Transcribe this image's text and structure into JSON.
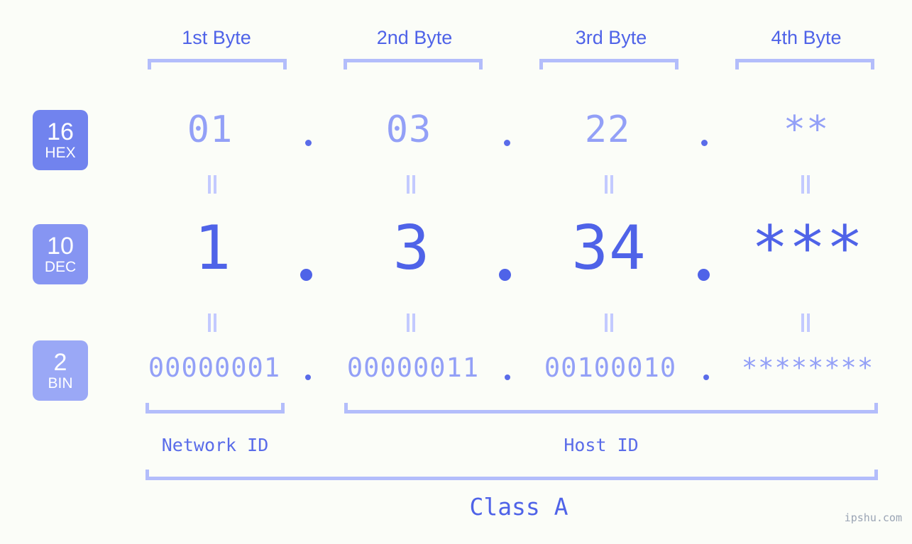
{
  "watermark": "ipshu.com",
  "colors": {
    "background": "#fbfdf8",
    "accent_strong": "#4f63e8",
    "accent_mid": "#5a6ce9",
    "accent_light": "#93a0f7",
    "bracket": "#b3bdfb",
    "equals": "#c3caff",
    "badge_hex": "#7183ee",
    "badge_dec": "#8695f2",
    "badge_bin": "#9aa8f6",
    "watermark_text": "#9aa4b4"
  },
  "headers": [
    {
      "label": "1st Byte"
    },
    {
      "label": "2nd Byte"
    },
    {
      "label": "3rd Byte"
    },
    {
      "label": "4th Byte"
    }
  ],
  "badges": [
    {
      "number": "16",
      "name": "HEX"
    },
    {
      "number": "10",
      "name": "DEC"
    },
    {
      "number": "2",
      "name": "BIN"
    }
  ],
  "rows": {
    "hex": {
      "base": "16",
      "name": "HEX",
      "values": [
        "01",
        "03",
        "22",
        "**"
      ]
    },
    "dec": {
      "base": "10",
      "name": "DEC",
      "values": [
        "1",
        "3",
        "34",
        "***"
      ]
    },
    "bin": {
      "base": "2",
      "name": "BIN",
      "values": [
        "00000001",
        "00000011",
        "00100010",
        "********"
      ]
    }
  },
  "separator": ".",
  "equals_glyph": "=",
  "regions": [
    {
      "label": "Network ID"
    },
    {
      "label": "Host ID"
    }
  ],
  "class": {
    "label": "Class A"
  }
}
